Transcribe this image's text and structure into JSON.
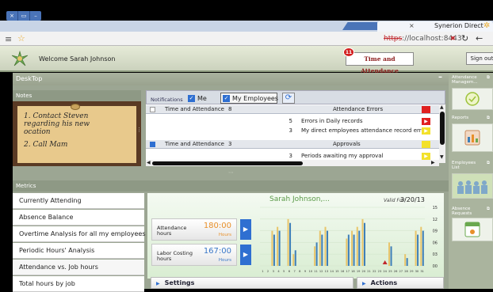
{
  "browser": {
    "tab_title": "Synerion Direct",
    "tab_close": "×",
    "window_buttons": [
      "×",
      "▭",
      "–"
    ],
    "url_scheme": "https",
    "url_rest": "://localhost:8443"
  },
  "header": {
    "welcome": "Welcome  Sarah Johnson",
    "time_attendance_button": "Time and Attendance",
    "badge_count": "11",
    "sign_out": "Sign out"
  },
  "desktop": {
    "title": "DeskTop",
    "notes_title": "Notes",
    "note_text": [
      "1. Contact Steven",
      "regarding his new",
      "ocation",
      "2. Call Mam"
    ],
    "notifications": {
      "label": "Notifications",
      "me": "Me",
      "my_employees": "My Employees",
      "rows": [
        {
          "type": "group",
          "name": "Time and Attendance",
          "count": "8",
          "category": "Attendance Errors",
          "flag_color": "#e02020"
        },
        {
          "type": "item",
          "num": "5",
          "desc": "Errors in Daily records",
          "flag_color": "#e02020"
        },
        {
          "type": "item",
          "num": "3",
          "desc": "My direct employees attendance record errors",
          "flag_color": "#f3e12a"
        },
        {
          "type": "group",
          "name": "Time and Attendance",
          "count": "3",
          "category": "Approvals",
          "flag_color": "#f3e12a"
        },
        {
          "type": "item",
          "num": "3",
          "desc": "Periods awaiting my approval",
          "flag_color": "#f3e12a"
        }
      ]
    }
  },
  "metrics": {
    "title": "Metrics",
    "items": [
      "Currently Attending",
      "Absence Balance",
      "Overtime Analysis for all my employees",
      "Periodic Hours' Analysis",
      "Attendance vs. Job hours",
      "Total hours by job"
    ],
    "panel_user": "Sarah Johnson,...",
    "valid_label": "Valid For:",
    "valid_date": "3/20/13",
    "kpis": [
      {
        "title": "Attendance hours",
        "value": "180:00",
        "unit": "Hours",
        "color": "#e8902a"
      },
      {
        "title": "Labor Costing hours",
        "value": "167:00",
        "unit": "Hours",
        "color": "#3a78c8"
      }
    ],
    "settings": "Settings",
    "actions": "Actions"
  },
  "sidebar": {
    "widgets": [
      {
        "title": "Attendance Managem..."
      },
      {
        "title": "Reports"
      },
      {
        "title": "Employees List"
      },
      {
        "title": "Absence Requests"
      }
    ]
  },
  "chart_data": {
    "type": "bar",
    "categories": [
      "1",
      "2",
      "3",
      "4",
      "5",
      "6",
      "7",
      "8",
      "9",
      "10",
      "11",
      "12",
      "13",
      "14",
      "15",
      "16",
      "17",
      "18",
      "19",
      "20",
      "21",
      "22",
      "23",
      "24",
      "25",
      "26",
      "27",
      "28",
      "29",
      "30",
      "31"
    ],
    "series": [
      {
        "values": [
          0,
          0,
          9,
          10,
          0,
          12,
          3,
          0,
          0,
          0,
          5,
          9,
          10,
          0,
          0,
          0,
          7,
          9,
          10,
          12,
          0,
          0,
          0,
          0,
          6,
          0,
          0,
          3,
          0,
          9,
          10
        ]
      },
      {
        "values": [
          0,
          0,
          8,
          9,
          0,
          11,
          4,
          0,
          0,
          0,
          6,
          8,
          9,
          0,
          0,
          0,
          8,
          8,
          9,
          11,
          0,
          0,
          0,
          0,
          5,
          0,
          0,
          2,
          0,
          8,
          9
        ]
      }
    ],
    "colors": [
      "#e8c56a",
      "#3e7fb8"
    ],
    "marker_color": "#c0282d",
    "y_ticks": [
      "15",
      "12",
      "09",
      "06",
      "03",
      "00"
    ],
    "ylim": [
      0,
      15
    ]
  }
}
